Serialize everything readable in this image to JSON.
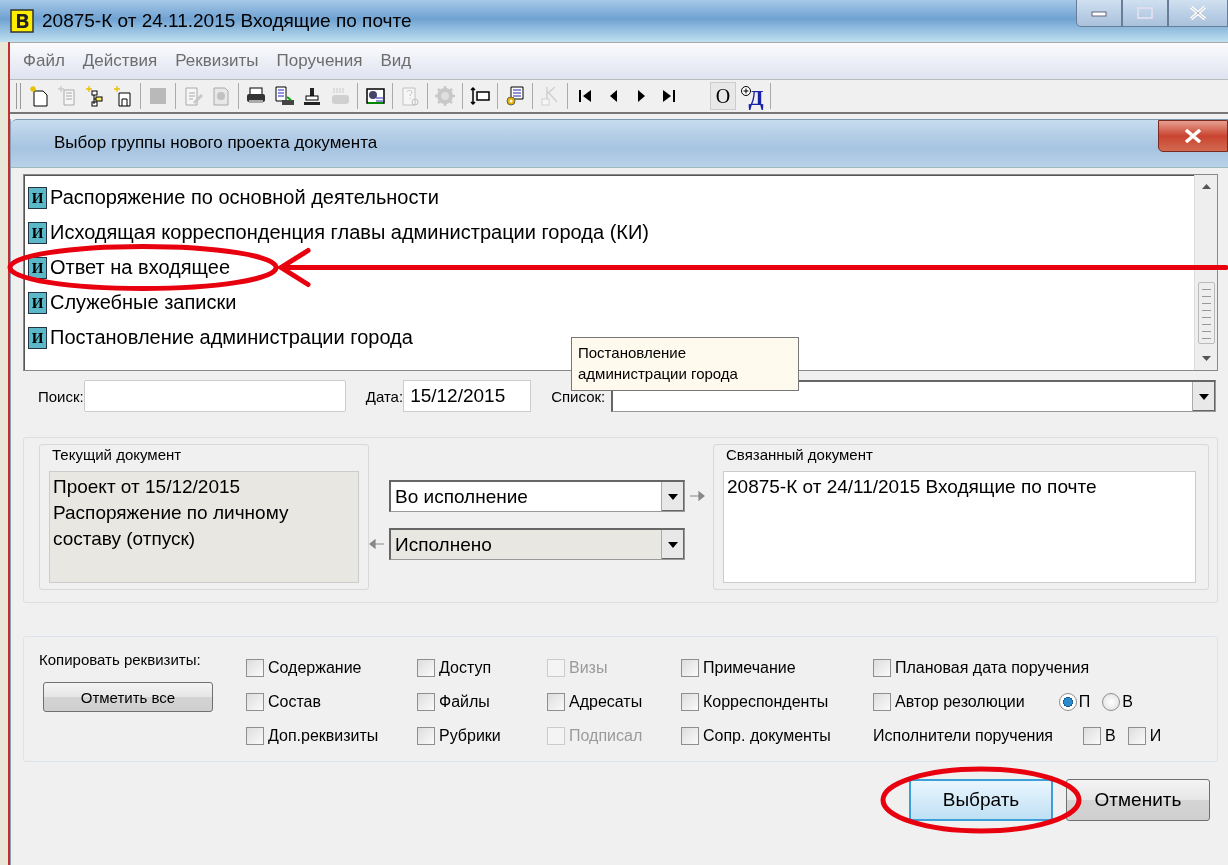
{
  "window": {
    "title": "20875-К от 24.11.2015 Входящие по почте"
  },
  "menu": [
    "Файл",
    "Действия",
    "Реквизиты",
    "Поручения",
    "Вид"
  ],
  "toolbar": [
    {
      "kind": "new-doc",
      "disabled": false
    },
    {
      "kind": "copy-doc",
      "disabled": true
    },
    {
      "kind": "new-tree",
      "disabled": false
    },
    {
      "kind": "new-folder",
      "disabled": false
    },
    {
      "kind": "sep"
    },
    {
      "kind": "stop",
      "disabled": true
    },
    {
      "kind": "sep"
    },
    {
      "kind": "edit",
      "disabled": true
    },
    {
      "kind": "view",
      "disabled": true
    },
    {
      "kind": "sep"
    },
    {
      "kind": "print",
      "disabled": false
    },
    {
      "kind": "scan",
      "disabled": false
    },
    {
      "kind": "stamp",
      "disabled": false
    },
    {
      "kind": "fax",
      "disabled": true
    },
    {
      "kind": "sep"
    },
    {
      "kind": "monitor",
      "disabled": false
    },
    {
      "kind": "sep"
    },
    {
      "kind": "help-doc",
      "disabled": true
    },
    {
      "kind": "sep"
    },
    {
      "kind": "gear",
      "disabled": true
    },
    {
      "kind": "sep"
    },
    {
      "kind": "resize",
      "disabled": false
    },
    {
      "kind": "sep"
    },
    {
      "kind": "tool-doc",
      "disabled": false
    },
    {
      "kind": "sep"
    },
    {
      "kind": "sign",
      "disabled": true
    },
    {
      "kind": "sep"
    },
    {
      "kind": "first",
      "disabled": false
    },
    {
      "kind": "prev",
      "disabled": false
    },
    {
      "kind": "next",
      "disabled": false
    },
    {
      "kind": "last",
      "disabled": false
    },
    {
      "kind": "gap"
    },
    {
      "kind": "text",
      "label": "О",
      "pressed": true
    },
    {
      "kind": "zoom-letter",
      "label": "Д",
      "pressed": false
    },
    {
      "kind": "sep"
    }
  ],
  "dialog": {
    "title": "Выбор группы нового проекта документа",
    "groups": [
      {
        "badge": "И",
        "label": "Распоряжение по основной деятельности",
        "circled": false,
        "arrow": false
      },
      {
        "badge": "И",
        "label": "Исходящая корреспонденция главы администрации города (КИ)",
        "circled": false,
        "arrow": false
      },
      {
        "badge": "И",
        "label": "Ответ на входящее",
        "circled": true,
        "arrow": true
      },
      {
        "badge": "И",
        "label": "Служебные записки",
        "circled": false,
        "arrow": false
      },
      {
        "badge": "И",
        "label": "Постановление администрации города",
        "circled": false,
        "arrow": false
      }
    ],
    "search": {
      "label": "Поиск:"
    },
    "date": {
      "label": "Дата:",
      "value": "15/12/2015"
    },
    "list_filter": {
      "label": "Список:"
    },
    "tooltip": "Постановление администрации города",
    "current_document": {
      "title": "Текущий документ",
      "text": "Проект от 15/12/2015 Распоряжение по личному составу (отпуск)"
    },
    "link_types": [
      {
        "value": "Во исполнение",
        "kind": "forward",
        "readonly": false
      },
      {
        "value": "Исполнено",
        "kind": "backward",
        "readonly": true
      }
    ],
    "linked_document": {
      "title": "Связанный документ",
      "text": "20875-К от 24/11/2015 Входящие по почте"
    },
    "copy": {
      "label": "Копировать реквизиты:",
      "button": "Отметить все",
      "columns": [
        [
          {
            "kind": "checkbox",
            "label": "Содержание",
            "checked": false,
            "disabled": false
          },
          {
            "kind": "checkbox",
            "label": "Состав",
            "checked": false,
            "disabled": false
          },
          {
            "kind": "checkbox",
            "label": "Доп.реквизиты",
            "checked": false,
            "disabled": false
          }
        ],
        [
          {
            "kind": "checkbox",
            "label": "Доступ",
            "checked": false,
            "disabled": false
          },
          {
            "kind": "checkbox",
            "label": "Файлы",
            "checked": false,
            "disabled": false
          },
          {
            "kind": "checkbox",
            "label": "Рубрики",
            "checked": false,
            "disabled": false
          }
        ],
        [
          {
            "kind": "checkbox",
            "label": "Визы",
            "checked": false,
            "disabled": true
          },
          {
            "kind": "checkbox",
            "label": "Адресаты",
            "checked": false,
            "disabled": false
          },
          {
            "kind": "checkbox",
            "label": "Подписал",
            "checked": false,
            "disabled": true
          }
        ],
        [
          {
            "kind": "checkbox",
            "label": "Примечание",
            "checked": false,
            "disabled": false
          },
          {
            "kind": "checkbox",
            "label": "Корреспонденты",
            "checked": false,
            "disabled": false
          },
          {
            "kind": "checkbox",
            "label": "Сопр. документы",
            "checked": false,
            "disabled": false
          }
        ],
        [
          {
            "kind": "checkbox",
            "label": "Плановая дата поручения",
            "checked": false,
            "disabled": false
          },
          {
            "kind": "checkbox-radios",
            "label": "Автор резолюции",
            "checked": false,
            "disabled": false,
            "radios": [
              {
                "label": "П",
                "selected": true
              },
              {
                "label": "В",
                "selected": false
              }
            ]
          },
          {
            "kind": "label-checks",
            "label": "Исполнители поручения",
            "checks": [
              {
                "label": "В",
                "checked": false
              },
              {
                "label": "И",
                "checked": false
              }
            ]
          }
        ]
      ]
    },
    "buttons": [
      {
        "label": "Выбрать",
        "focused": true,
        "circled": true
      },
      {
        "label": "Отменить",
        "focused": false,
        "circled": false
      }
    ]
  }
}
